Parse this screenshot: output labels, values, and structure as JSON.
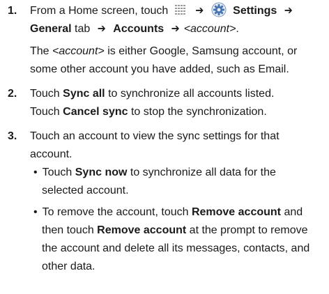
{
  "steps": [
    {
      "number": "1.",
      "line1_a": "From a Home screen, touch",
      "line1_settings": "Settings",
      "line2_general": "General",
      "line2_tab": "tab",
      "line2_accounts": "Accounts",
      "line2_account_var": "<account>",
      "line2_end": ".",
      "para_l1_a": "The ",
      "para_l1_var": "<account>",
      "para_l1_b": " is either Google, Samsung account, or",
      "para_l2": "some other account you have added, such as Email."
    },
    {
      "number": "2.",
      "l1_a": "Touch ",
      "l1_b": "Sync all",
      "l1_c": " to synchronize all accounts listed.",
      "l2_a": "Touch ",
      "l2_b": "Cancel sync",
      "l2_c": " to stop the synchronization."
    },
    {
      "number": "3.",
      "l1": "Touch an account to view the sync settings for that",
      "l2": "account.",
      "bullets": [
        {
          "l1_a": "Touch ",
          "l1_b": "Sync now",
          "l1_c": " to synchronize all data for the",
          "l2": "selected account."
        },
        {
          "l1_a": "To remove the account, touch ",
          "l1_b": "Remove account",
          "l1_c": " and",
          "l2_a": "then touch ",
          "l2_b": "Remove account",
          "l2_c": " at the prompt to remove",
          "l3": "the account and delete all its messages, contacts, and",
          "l4": "other data."
        }
      ]
    }
  ],
  "symbols": {
    "arrow": "➔",
    "bullet": "•"
  },
  "icons": {
    "apps": "apps-grid-icon",
    "settings": "settings-gear-icon"
  }
}
